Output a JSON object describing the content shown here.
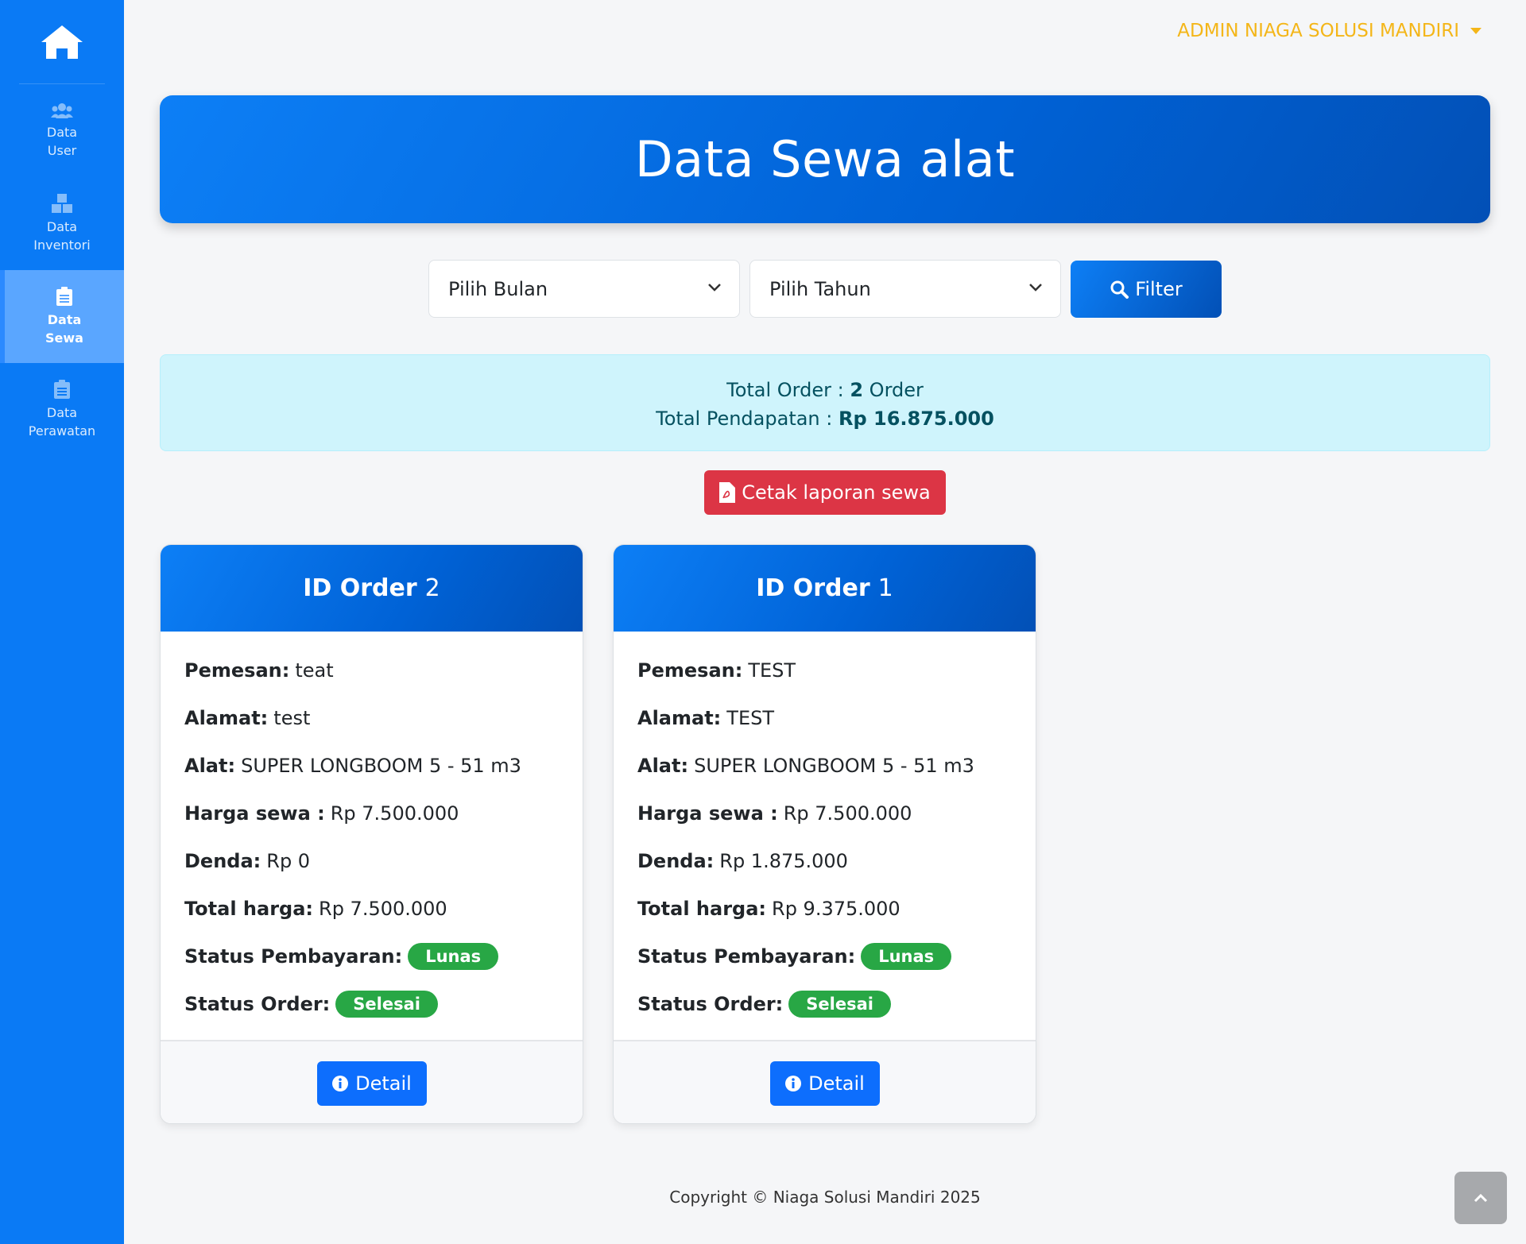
{
  "sidebar": {
    "items": [
      {
        "label_line1": "Data",
        "label_line2": "User",
        "icon": "users-icon"
      },
      {
        "label_line1": "Data",
        "label_line2": "Inventori",
        "icon": "boxes-icon"
      },
      {
        "label_line1": "Data",
        "label_line2": "Sewa",
        "icon": "clipboard-icon"
      },
      {
        "label_line1": "Data",
        "label_line2": "Perawatan",
        "icon": "clipboard-icon"
      }
    ]
  },
  "header": {
    "user_name": "ADMIN NIAGA SOLUSI MANDIRI"
  },
  "page": {
    "title": "Data Sewa alat"
  },
  "filter": {
    "month_value": "Pilih Bulan",
    "year_value": "Pilih Tahun",
    "button_label": "Filter"
  },
  "summary": {
    "order_label": "Total Order : ",
    "order_count": "2",
    "order_unit": " Order",
    "income_label": "Total Pendapatan : ",
    "income_value": "Rp 16.875.000"
  },
  "print_button": "Cetak laporan sewa",
  "labels": {
    "pemesan": "Pemesan:",
    "alamat": "Alamat:",
    "alat": "Alat:",
    "harga": "Harga sewa :",
    "denda": "Denda:",
    "total": "Total harga:",
    "status_bayar": "Status Pembayaran:",
    "status_order": "Status Order:",
    "id_order": "ID Order",
    "detail": "Detail"
  },
  "orders": [
    {
      "id": "2",
      "pemesan": "teat",
      "alamat": "test",
      "alat": "SUPER LONGBOOM 5 - 51 m3",
      "harga": "Rp 7.500.000",
      "denda": "Rp 0",
      "total": "Rp 7.500.000",
      "status_bayar": "Lunas",
      "status_order": "Selesai"
    },
    {
      "id": "1",
      "pemesan": "TEST",
      "alamat": "TEST",
      "alat": "SUPER LONGBOOM 5 - 51 m3",
      "harga": "Rp 7.500.000",
      "denda": "Rp 1.875.000",
      "total": "Rp 9.375.000",
      "status_bayar": "Lunas",
      "status_order": "Selesai"
    }
  ],
  "footer": {
    "copyright": "Copyright © Niaga Solusi Mandiri 2025"
  },
  "colors": {
    "sidebar": "#0a7af5",
    "primary": "#0d6efd",
    "danger": "#dc3545",
    "success": "#28a745",
    "info_bg": "#cff4fc",
    "user_accent": "#f4b619"
  }
}
